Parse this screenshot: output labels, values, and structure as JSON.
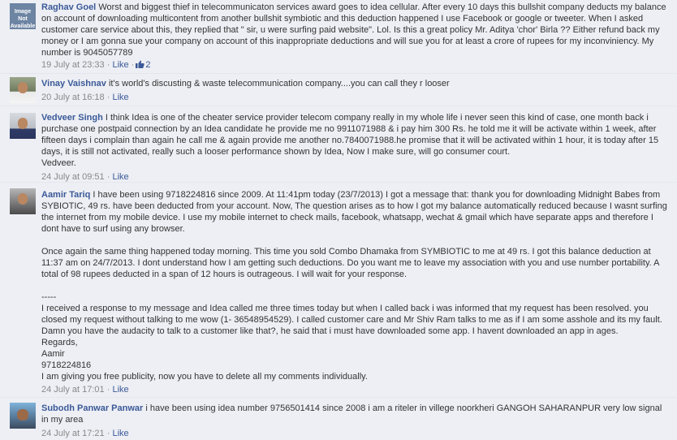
{
  "comments": [
    {
      "author": "Raghav Goel",
      "avatar_label": "Image Not Available",
      "text": "Worst and biggest thief in telecommunicaton services award goes to idea cellular. After every 10 days this bullshit company deducts my balance on account of downloading multicontent from another bullshit symbiotic and this deduction happened I use Facebook or google or tweeter. When I asked customer care service about this, they replied that \" sir, u were surfing paid website\". Lol. Is this a great policy Mr. Aditya 'chor' Birla ?? Either refund back my money or I am gonna sue your company on account of this inappropriate deductions and will sue you for at least a crore of rupees for my inconviniency. My number is 9045057789",
      "timestamp": "19 July at 23:33",
      "like_label": "Like",
      "like_count": "2"
    },
    {
      "author": "Vinay Vaishnav",
      "text": "it's world's discusting & waste telecommunication company....you can call they r looser",
      "timestamp": "20 July at 16:18",
      "like_label": "Like"
    },
    {
      "author": "Vedveer Singh",
      "text": "I think Idea is one of the cheater service provider telecom company really in my whole life i never seen this kind of case, one month back i purchase one postpaid connection by an Idea candidate he provide me no 9911071988 & i pay him 300 Rs. he told me it will be activate within 1 week, after fifteen days i complain than again he call me & again provide me another no.7840071988.he promise that it will be activated within 1 hour, it is today after 15 days, it is still not activated, really such a looser performance shown by Idea, Now I make sure, will go consumer court.\nVedveer.",
      "timestamp": "24 July at 09:51",
      "like_label": "Like"
    },
    {
      "author": "Aamir Tariq",
      "text": "I have been using 9718224816 since 2009. At 11:41pm today (23/7/2013) I got a message that: thank you for downloading Midnight Babes from SYBIOTIC, 49 rs. have been deducted from your account. Now, The question arises as to how I got my balance automatically reduced because I wasnt surfing the internet from my mobile device. I use my mobile internet to check mails, facebook, whatsapp, wechat & gmail which have separate apps and therefore I dont have to surf using any browser.\n\nOnce again the same thing happened today morning. This time you sold Combo Dhamaka from SYMBIOTIC to me at 49 rs. I got this balance deduction at 11:37 am on 24/7/2013. I dont understand how I am getting such deductions. Do you want me to leave my association with you and use number portability. A total of 98 rupees deducted in a span of 12 hours is outrageous. I will wait for your response.\n\n-----\nI received a response to my message and Idea called me three times today but when I called back i was informed that my request has been resolved. you closed my request without talking to me wow (1- 36548954529). I called customer care and Mr Shiv Ram talks to me as if I am some asshole and its my fault. Damn you have the audacity to talk to a customer like that?, he said that i must have downloaded some app. I havent downloaded an app in ages.\nRegards,\nAamir\n9718224816\nI am giving you free publicity, now you have to delete all my comments individually.",
      "timestamp": "24 July at 17:01",
      "like_label": "Like"
    },
    {
      "author": "Subodh Panwar Panwar",
      "text": "i have been using idea number 9756501414 since 2008 i am a riteler in villege noorkheri GANGOH SAHARANPUR very low signal in my area",
      "timestamp": "24 July at 17:21",
      "like_label": "Like"
    }
  ],
  "meta_separator": "·",
  "colors": {
    "link": "#3b5998",
    "background": "#edeff4",
    "meta": "#888888"
  }
}
